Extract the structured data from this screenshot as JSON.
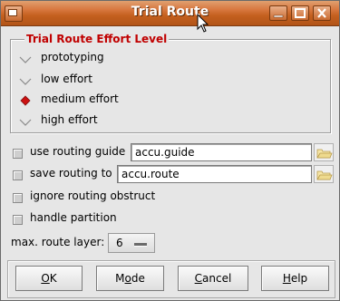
{
  "window": {
    "title": "Trial Route",
    "menu_icon": "window-menu-icon",
    "buttons": [
      "minimize-icon",
      "maximize-icon",
      "close-icon"
    ]
  },
  "effort": {
    "group_title": "Trial Route Effort Level",
    "options": [
      {
        "label": "prototyping",
        "selected": false
      },
      {
        "label": "low effort",
        "selected": false
      },
      {
        "label": "medium effort",
        "selected": true
      },
      {
        "label": "high effort",
        "selected": false
      }
    ]
  },
  "options": {
    "use_routing_guide": {
      "label": "use routing guide",
      "checked": false,
      "value": "accu.guide"
    },
    "save_routing_to": {
      "label": "save routing to",
      "checked": false,
      "value": "accu.route"
    },
    "ignore_routing_obstruct": {
      "label": "ignore routing obstruct",
      "checked": false
    },
    "handle_partition": {
      "label": "handle partition",
      "checked": false
    }
  },
  "max_route_layer": {
    "label": "max. route layer:",
    "value": "6"
  },
  "actions": {
    "ok": {
      "pre": "",
      "key": "O",
      "post": "K"
    },
    "mode": {
      "pre": "M",
      "key": "o",
      "post": "de"
    },
    "cancel": {
      "pre": "",
      "key": "C",
      "post": "ancel"
    },
    "help": {
      "pre": "",
      "key": "H",
      "post": "elp"
    }
  },
  "colors": {
    "titlebar": "#c4601f",
    "group_title": "#c00000",
    "radio_selected": "#cc1111"
  }
}
